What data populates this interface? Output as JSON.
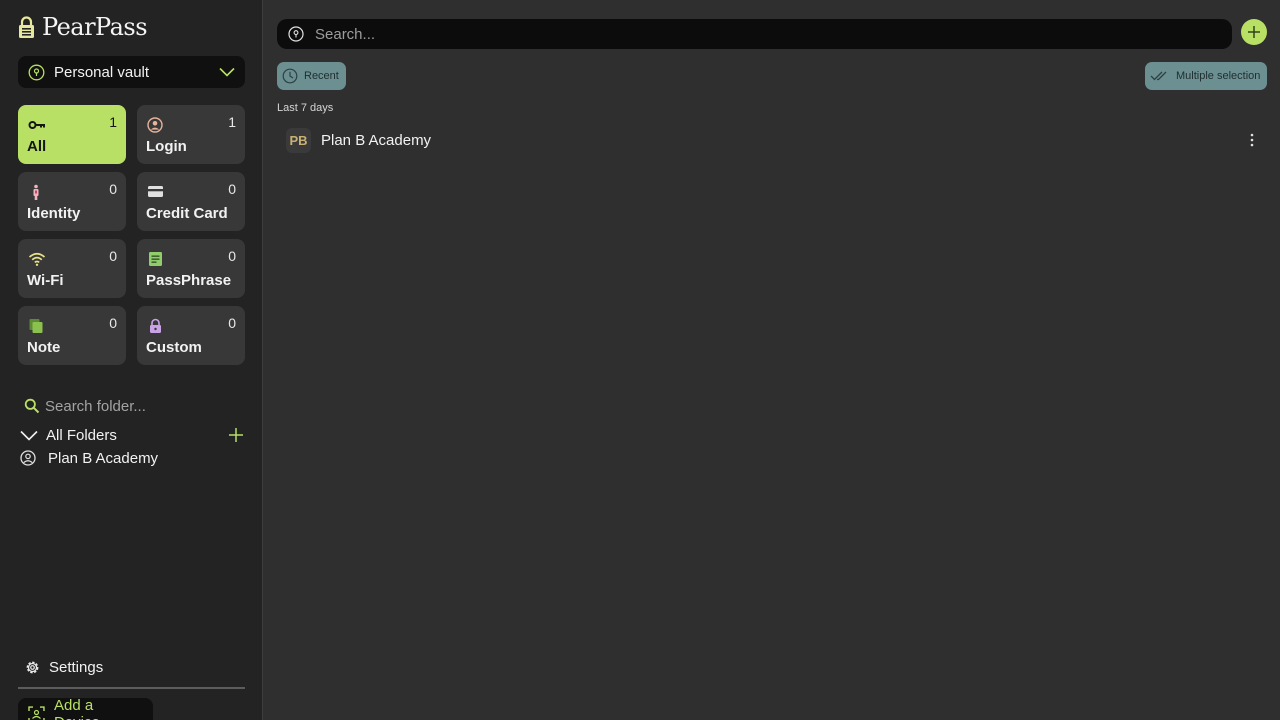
{
  "app": {
    "name": "PearPass"
  },
  "vault": {
    "selected": "Personal vault"
  },
  "categories": [
    {
      "label": "All",
      "count": "1",
      "icon": "key-icon"
    },
    {
      "label": "Login",
      "count": "1",
      "icon": "user-circle-icon"
    },
    {
      "label": "Identity",
      "count": "0",
      "icon": "id-badge-icon"
    },
    {
      "label": "Credit Card",
      "count": "0",
      "icon": "credit-card-icon"
    },
    {
      "label": "Wi-Fi",
      "count": "0",
      "icon": "wifi-icon"
    },
    {
      "label": "PassPhrase",
      "count": "0",
      "icon": "document-icon"
    },
    {
      "label": "Note",
      "count": "0",
      "icon": "note-icon"
    },
    {
      "label": "Custom",
      "count": "0",
      "icon": "lock-icon"
    }
  ],
  "folders": {
    "search_placeholder": "Search folder...",
    "all_label": "All Folders",
    "items": [
      {
        "label": "Plan B Academy"
      }
    ]
  },
  "footer": {
    "settings_label": "Settings",
    "add_device_label": "Add a Device"
  },
  "main": {
    "search_placeholder": "Search...",
    "recent_label": "Recent",
    "multiple_selection_label": "Multiple selection",
    "section_heading": "Last 7 days",
    "items": [
      {
        "initials": "PB",
        "title": "Plan B Academy"
      }
    ]
  },
  "colors": {
    "accent": "#b8e065",
    "chip": "#6c8f92",
    "sidebar": "#232323",
    "background": "#2f2f2f"
  }
}
